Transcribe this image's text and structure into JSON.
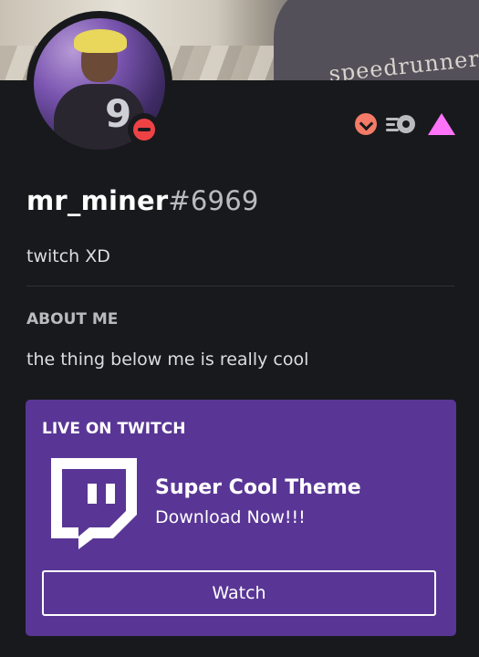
{
  "banner": {
    "shirt_text": "speedrunners"
  },
  "profile": {
    "username": "mr_miner",
    "discriminator": "#6969",
    "custom_status": "twitch XD",
    "status": "do-not-disturb",
    "badges": [
      "hypesquad-brilliance-icon",
      "server-booster-icon",
      "nitro-icon"
    ]
  },
  "about": {
    "title": "ABOUT ME",
    "text": "the thing below me is really cool"
  },
  "activity": {
    "header": "LIVE ON TWITCH",
    "name": "Super Cool Theme",
    "details": "Download Now!!!",
    "button_label": "Watch"
  },
  "colors": {
    "background": "#18191c",
    "twitch_card": "#593695",
    "dnd": "#ed4245",
    "hypesquad": "#f47b67",
    "nitro": "#ff73fa"
  }
}
